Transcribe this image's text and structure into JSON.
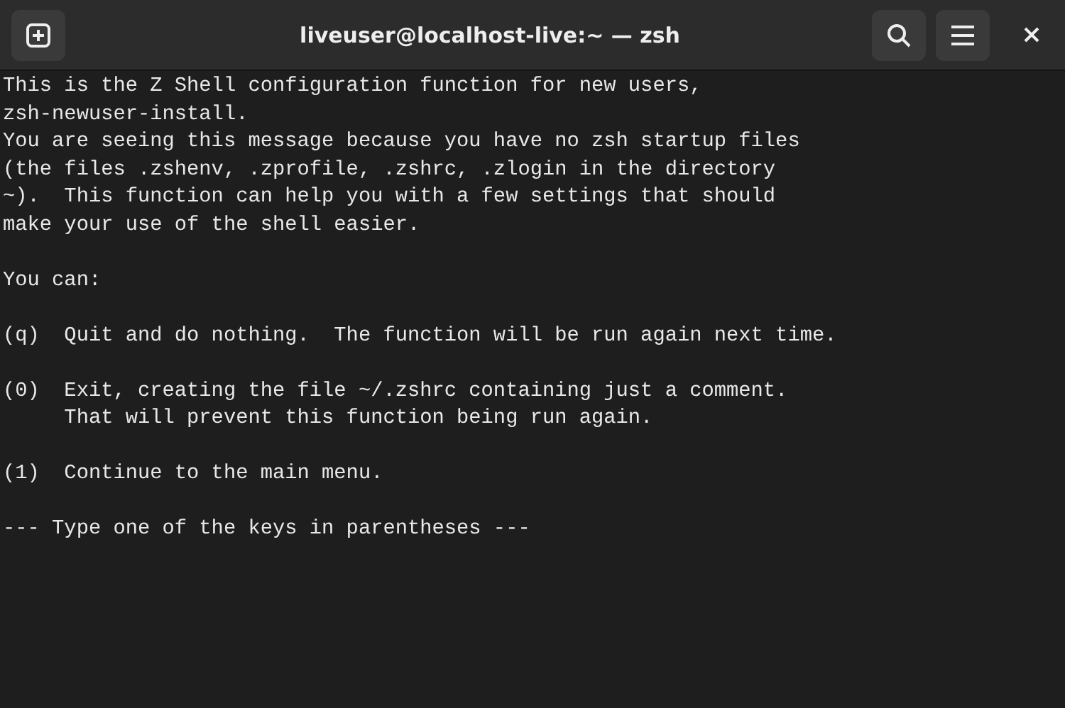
{
  "window": {
    "title": "liveuser@localhost-live:~ — zsh"
  },
  "terminal": {
    "blocks": [
      [
        "This is the Z Shell configuration function for new users,",
        "zsh-newuser-install.",
        "You are seeing this message because you have no zsh startup files",
        "(the files .zshenv, .zprofile, .zshrc, .zlogin in the directory",
        "~).  This function can help you with a few settings that should",
        "make your use of the shell easier."
      ],
      [
        "You can:"
      ],
      [
        "(q)  Quit and do nothing.  The function will be run again next time."
      ],
      [
        "(0)  Exit, creating the file ~/.zshrc containing just a comment.",
        "     That will prevent this function being run again."
      ],
      [
        "(1)  Continue to the main menu."
      ],
      [
        "--- Type one of the keys in parentheses ---"
      ]
    ]
  }
}
